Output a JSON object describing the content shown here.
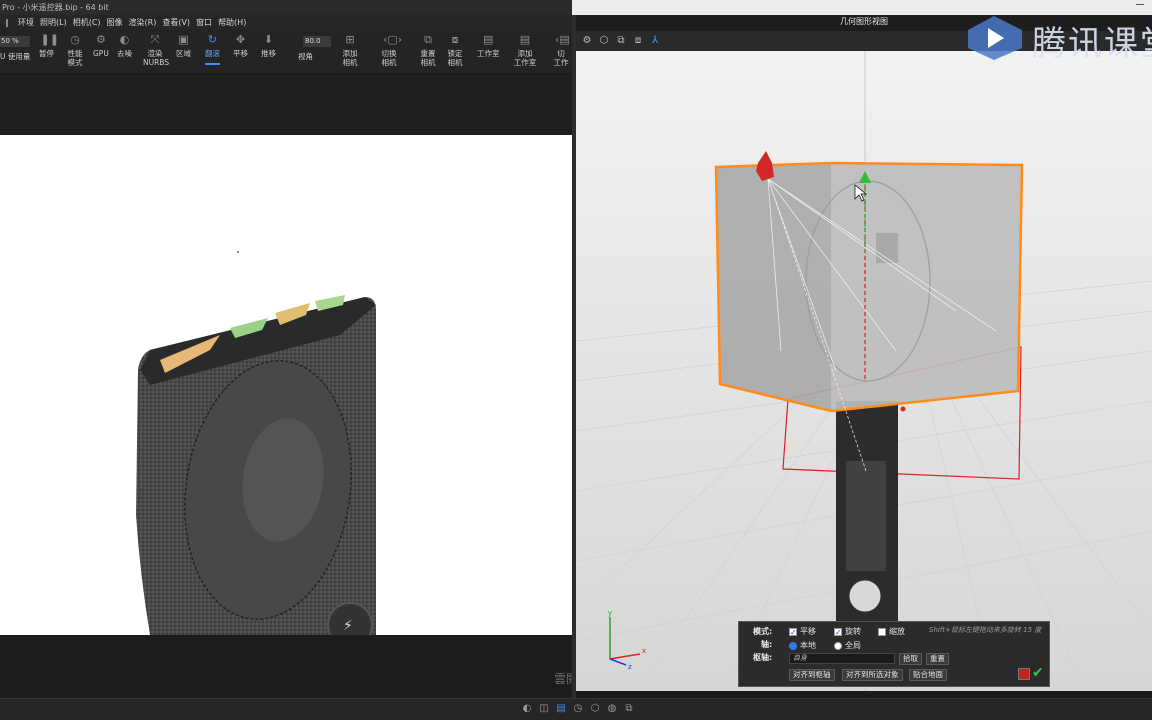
{
  "window": {
    "title": "Pro - 小米遥控器.bip - 64 bit"
  },
  "menu": [
    "环境",
    "照明(L)",
    "相机(C)",
    "图像",
    "渲染(R)",
    "查看(V)",
    "窗口",
    "帮助(H)"
  ],
  "toolbar": {
    "zoom_value": "50 %",
    "fov_value": "80.0",
    "items": [
      {
        "label": "U 使用量",
        "icon": "gpu-usage-icon"
      },
      {
        "label": "暂停",
        "icon": "pause-icon"
      },
      {
        "label": "性能\n模式",
        "icon": "performance-mode-icon"
      },
      {
        "label": "GPU",
        "icon": "gpu-icon"
      },
      {
        "label": "去噪",
        "icon": "denoise-icon"
      },
      {
        "label": "渲染\nNURBS",
        "icon": "nurbs-icon"
      },
      {
        "label": "区域",
        "icon": "region-icon"
      },
      {
        "label": "翻滚",
        "icon": "tumble-icon"
      },
      {
        "label": "平移",
        "icon": "pan-icon"
      },
      {
        "label": "推移",
        "icon": "dolly-icon"
      },
      {
        "label": "视角",
        "icon": "fov-icon"
      },
      {
        "label": "添加\n相机",
        "icon": "add-camera-icon"
      },
      {
        "label": "切换\n相机",
        "icon": "switch-camera-icon"
      },
      {
        "label": "重置\n相机",
        "icon": "reset-camera-icon"
      },
      {
        "label": "锁定\n相机",
        "icon": "lock-camera-icon"
      },
      {
        "label": "工作室",
        "icon": "studio-icon"
      },
      {
        "label": "添加\n工作室",
        "icon": "add-studio-icon"
      },
      {
        "label": "切\n工作",
        "icon": "switch-studio-icon"
      }
    ],
    "active": "翻滚"
  },
  "render_watermark": "雲閱賴肖...",
  "geometry_view": {
    "title": "几何图形视图"
  },
  "brand": {
    "text": "腾讯课堂"
  },
  "transform_panel": {
    "mode_label": "模式:",
    "mode_translate": "平移",
    "mode_rotate": "旋转",
    "mode_scale": "缩放",
    "axis_label": "轴:",
    "axis_local": "本地",
    "axis_global": "全局",
    "pivot_label": "枢轴:",
    "pivot_value": "自身",
    "pick_button": "拾取",
    "reset_button": "重置",
    "align_pivot_button": "对齐到枢轴",
    "align_selected_button": "对齐到所选对象",
    "snap_ground_button": "贴合地面",
    "hint": "Shift+鼠标左键拖动来多旋转 15 度",
    "translate_checked": true,
    "rotate_checked": true,
    "scale_checked": false,
    "axis_selected": "本地"
  },
  "colors": {
    "accent": "#3b8cff",
    "selection": "#ff8c1a",
    "bbox": "#e02020"
  }
}
